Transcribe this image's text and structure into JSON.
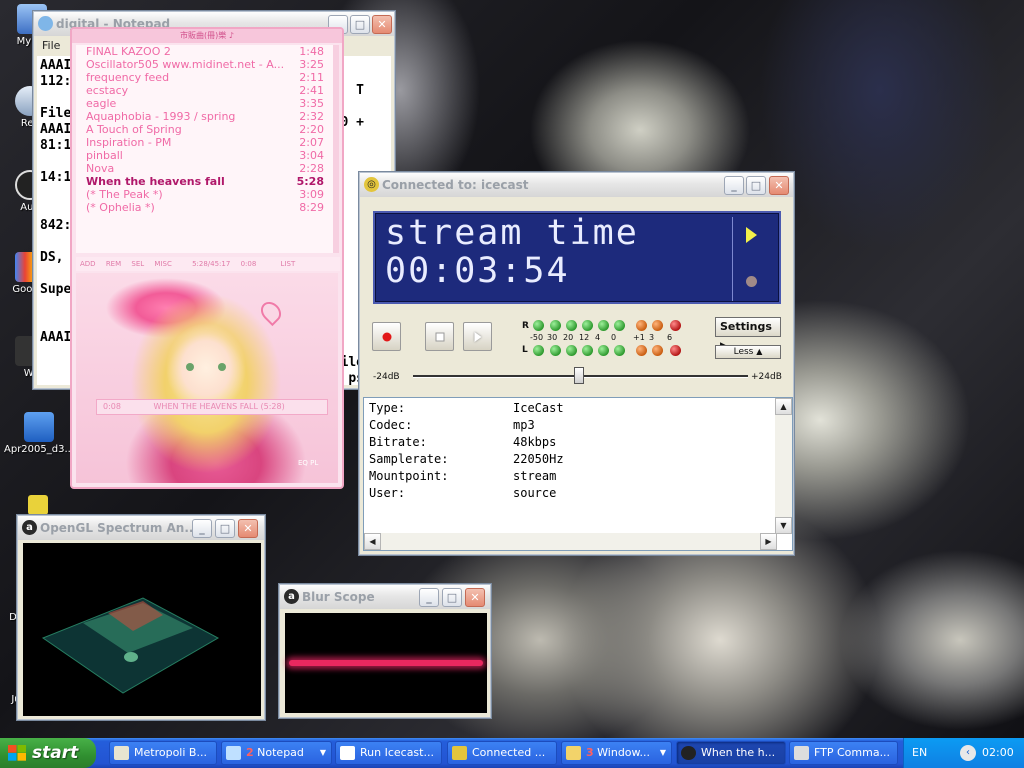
{
  "desktop": {
    "icons": [
      {
        "label": "My Co"
      },
      {
        "label": "Rec"
      },
      {
        "label": "Aud"
      },
      {
        "label": "Google"
      },
      {
        "label": "Wi"
      },
      {
        "label": "Apr2005_d3..."
      },
      {
        "label": "Da"
      },
      {
        "label": "Ju"
      }
    ]
  },
  "notepad": {
    "title": "digital - Notepad",
    "menu": "File",
    "lines": [
      "AAAII",
      "112:5",
      "",
      "File-",
      "AAAII",
      "81:15",
      "",
      "14:15",
      "",
      "",
      "842:",
      "",
      "DS, F",
      "",
      "Supe",
      "",
      "",
      "AAAII"
    ],
    "right_text": [
      "T",
      "0 +",
      "ile",
      "ps"
    ]
  },
  "winamp": {
    "header": "市販曲(冊)樂 ♪",
    "playlist": [
      {
        "title": "FINAL KAZOO 2",
        "dur": "1:48"
      },
      {
        "title": "Oscillator505 www.midinet.net - A...",
        "dur": "3:25"
      },
      {
        "title": "frequency feed",
        "dur": "2:11"
      },
      {
        "title": "ecstacy",
        "dur": "2:41"
      },
      {
        "title": "eagle",
        "dur": "3:35"
      },
      {
        "title": "Aquaphobia  - 1993 / spring",
        "dur": "2:32"
      },
      {
        "title": "A Touch of Spring",
        "dur": "2:20"
      },
      {
        "title": "Inspiration - PM",
        "dur": "2:07"
      },
      {
        "title": "pinball",
        "dur": "3:04"
      },
      {
        "title": "Nova",
        "dur": "2:28"
      },
      {
        "title": "When the heavens fall",
        "dur": "5:28",
        "current": true
      },
      {
        "title": "(* The Peak *)",
        "dur": "3:09"
      },
      {
        "title": "(* Ophelia *)",
        "dur": "8:29"
      }
    ],
    "buttons": [
      "ADD",
      "REM",
      "SEL",
      "MISC"
    ],
    "total_time": "5:28/45:17",
    "elapsed": "0:08",
    "list_btn": "LIST",
    "mini_text": "WHEN THE HEAVENS FALL (5:28)",
    "mini_time": "0:08",
    "eq_pl": "EQ  PL"
  },
  "icecast": {
    "title": "Connected to: icecast",
    "lcd_line1": "stream time",
    "lcd_line2": "00:03:54",
    "vu_scale": [
      "-50",
      "30",
      "20",
      "12",
      "4",
      "0",
      "+1",
      "3",
      "6"
    ],
    "channel_r": "R",
    "channel_l": "L",
    "settings_label": "Settings",
    "less_label": "Less",
    "slider_min": "-24dB",
    "slider_max": "+24dB",
    "info": [
      {
        "key": "Type:",
        "value": "IceCast"
      },
      {
        "key": "Codec:",
        "value": "mp3"
      },
      {
        "key": "Bitrate:",
        "value": "48kbps"
      },
      {
        "key": "Samplerate:",
        "value": "22050Hz"
      },
      {
        "key": "Mountpoint:",
        "value": "stream"
      },
      {
        "key": "User:",
        "value": "source"
      }
    ]
  },
  "opengl": {
    "title": "OpenGL Spectrum An..."
  },
  "blurscope": {
    "title": "Blur Scope"
  },
  "taskbar": {
    "start_label": "start",
    "tasks": [
      {
        "label": "Metropoli B..."
      },
      {
        "num": "2",
        "label": "Notepad"
      },
      {
        "label": "Run Icecast..."
      },
      {
        "label": "Connected ..."
      },
      {
        "num": "3",
        "label": "Window..."
      },
      {
        "label": "When the h..."
      },
      {
        "label": "FTP Comma..."
      }
    ],
    "lang": "EN",
    "clock": "02:00"
  }
}
